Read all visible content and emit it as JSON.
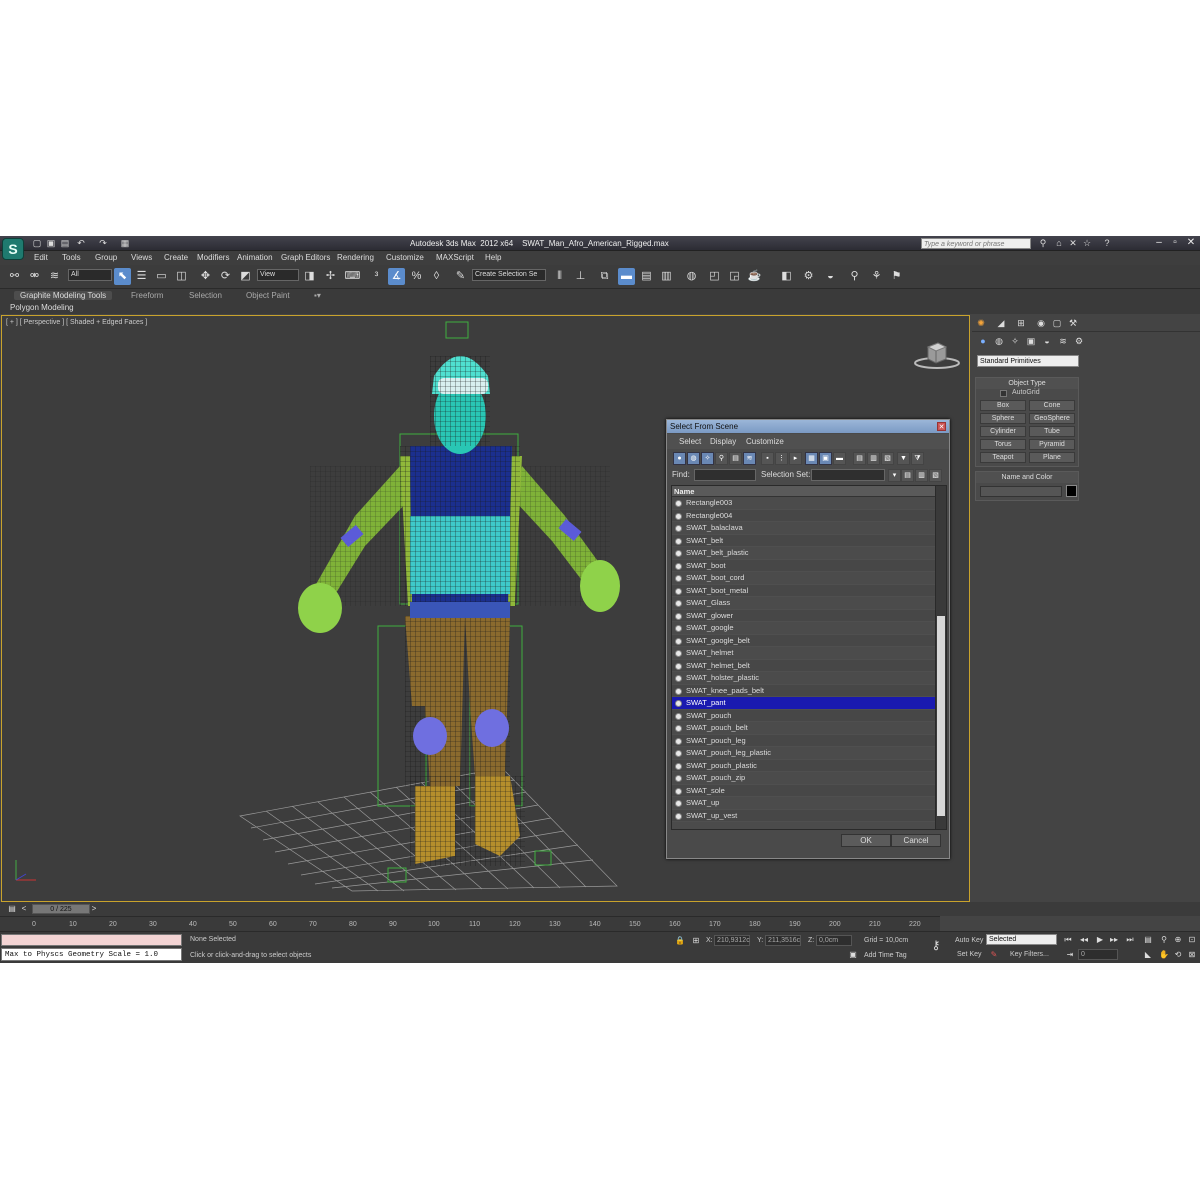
{
  "title": {
    "app": "Autodesk 3ds Max  2012 x64",
    "file": "SWAT_Man_Afro_American_Rigged.max",
    "search_placeholder": "Type a keyword or phrase"
  },
  "menu": [
    "Edit",
    "Tools",
    "Group",
    "Views",
    "Create",
    "Modifiers",
    "Animation",
    "Graph Editors",
    "Rendering",
    "Customize",
    "MAXScript",
    "Help"
  ],
  "toolbar": {
    "filter_value": "All",
    "coord_value": "View",
    "selection_set_value": "Create Selection Se"
  },
  "ribbon": {
    "tabs": [
      "Graphite Modeling Tools",
      "Freeform",
      "Selection",
      "Object Paint"
    ],
    "sub": "Polygon Modeling"
  },
  "viewport": {
    "label": "[ + ] [ Perspective ] [ Shaded + Edged Faces ]"
  },
  "dialog": {
    "title": "Select From Scene",
    "menu": [
      "Select",
      "Display",
      "Customize"
    ],
    "find_label": "Find:",
    "selset_label": "Selection Set:",
    "column_name": "Name",
    "items": [
      "Rectangle003",
      "Rectangle004",
      "SWAT_balaclava",
      "SWAT_belt",
      "SWAT_belt_plastic",
      "SWAT_boot",
      "SWAT_boot_cord",
      "SWAT_boot_metal",
      "SWAT_Glass",
      "SWAT_glower",
      "SWAT_google",
      "SWAT_google_belt",
      "SWAT_helmet",
      "SWAT_helmet_belt",
      "SWAT_holster_plastic",
      "SWAT_knee_pads_belt",
      "SWAT_pant",
      "SWAT_pouch",
      "SWAT_pouch_belt",
      "SWAT_pouch_leg",
      "SWAT_pouch_leg_plastic",
      "SWAT_pouch_plastic",
      "SWAT_pouch_zip",
      "SWAT_sole",
      "SWAT_up",
      "SWAT_up_vest"
    ],
    "selected_item": "SWAT_pant",
    "ok": "OK",
    "cancel": "Cancel"
  },
  "command_panel": {
    "dropdown": "Standard Primitives",
    "object_type_head": "Object Type",
    "autogrid": "AutoGrid",
    "primitives": [
      "Box",
      "Cone",
      "Sphere",
      "GeoSphere",
      "Cylinder",
      "Tube",
      "Torus",
      "Pyramid",
      "Teapot",
      "Plane"
    ],
    "name_color_head": "Name and Color"
  },
  "timeline": {
    "slider": "0 / 225",
    "ticks": [
      "0",
      "10",
      "20",
      "30",
      "40",
      "50",
      "60",
      "70",
      "80",
      "90",
      "100",
      "110",
      "120",
      "130",
      "140",
      "150",
      "160",
      "170",
      "180",
      "190",
      "200",
      "210",
      "220"
    ]
  },
  "status": {
    "maxscript": "Max to Physcs Geometry Scale = 1.0",
    "selection": "None Selected",
    "prompt": "Click or click-and-drag to select objects",
    "x_label": "X:",
    "x_value": "210,9312c",
    "y_label": "Y:",
    "y_value": "211,3516c",
    "z_label": "Z:",
    "z_value": "0,0cm",
    "grid": "Grid = 10,0cm",
    "add_time_tag": "Add Time Tag",
    "auto_key": "Auto Key",
    "set_key": "Set Key",
    "key_mode_value": "Selected",
    "key_filters": "Key Filters...",
    "frame": "0"
  },
  "colors": {
    "accent": "#5b8ccc",
    "viewport_border": "#c9a32c",
    "selection": "#1a1ab0"
  }
}
